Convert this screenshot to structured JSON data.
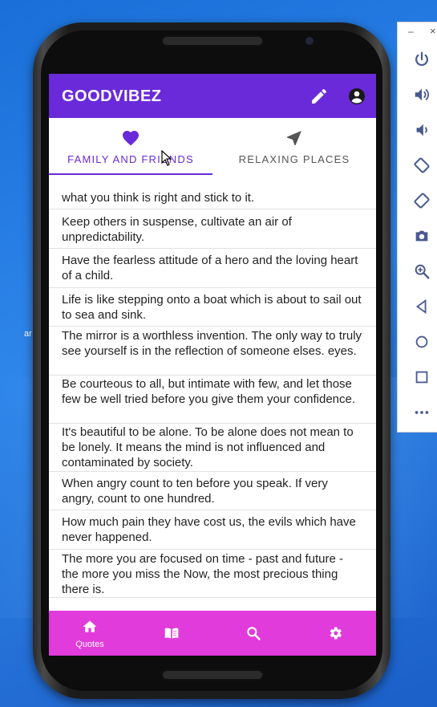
{
  "app": {
    "title": "GOODVIBEZ"
  },
  "tabs": [
    {
      "label": "FAMILY AND FRIENDS",
      "icon": "heart-icon",
      "active": true
    },
    {
      "label": "RELAXING PLACES",
      "icon": "navigation-arrow-icon",
      "active": false
    }
  ],
  "quotes": [
    "what you think is right and stick to it.",
    "Keep others in suspense, cultivate an air of unpredictability.",
    "Have the fearless attitude of a hero and the loving heart of a child.",
    "Life is like stepping onto a boat which is about to sail out to sea and sink.",
    "The mirror is a worthless invention. The only way to truly see yourself is in the reflection of someone elses. eyes.",
    "Be courteous to all, but intimate with few, and let those few be well tried before you give them your confidence.",
    "It's beautiful to be alone. To be alone does not mean to be lonely. It means the mind is not influenced and contaminated by society.",
    "When angry count to ten before you speak. If very angry, count to one hundred.",
    "How much pain they have cost us, the evils which have never happened.",
    "The more you are focused on time - past and future - the more you miss the Now, the most precious thing there is."
  ],
  "bottom_nav": [
    {
      "label": "Quotes",
      "icon": "home-icon",
      "active": true
    },
    {
      "label": "",
      "icon": "book-icon",
      "active": false
    },
    {
      "label": "",
      "icon": "search-icon",
      "active": false
    },
    {
      "label": "",
      "icon": "gear-icon",
      "active": false
    }
  ],
  "emulator_panel": {
    "minimize": "–",
    "close": "×",
    "buttons": [
      "power-icon",
      "volume-up-icon",
      "volume-down-icon",
      "rotate-left-icon",
      "rotate-right-icon",
      "camera-icon",
      "zoom-icon",
      "back-icon",
      "home-circle-icon",
      "overview-icon",
      "more-icon"
    ]
  },
  "desktop": {
    "label": "ar"
  },
  "colors": {
    "primary": "#6a2ad9",
    "bottom_nav": "#e13bdc",
    "emulator_icon": "#4a5a8f"
  }
}
